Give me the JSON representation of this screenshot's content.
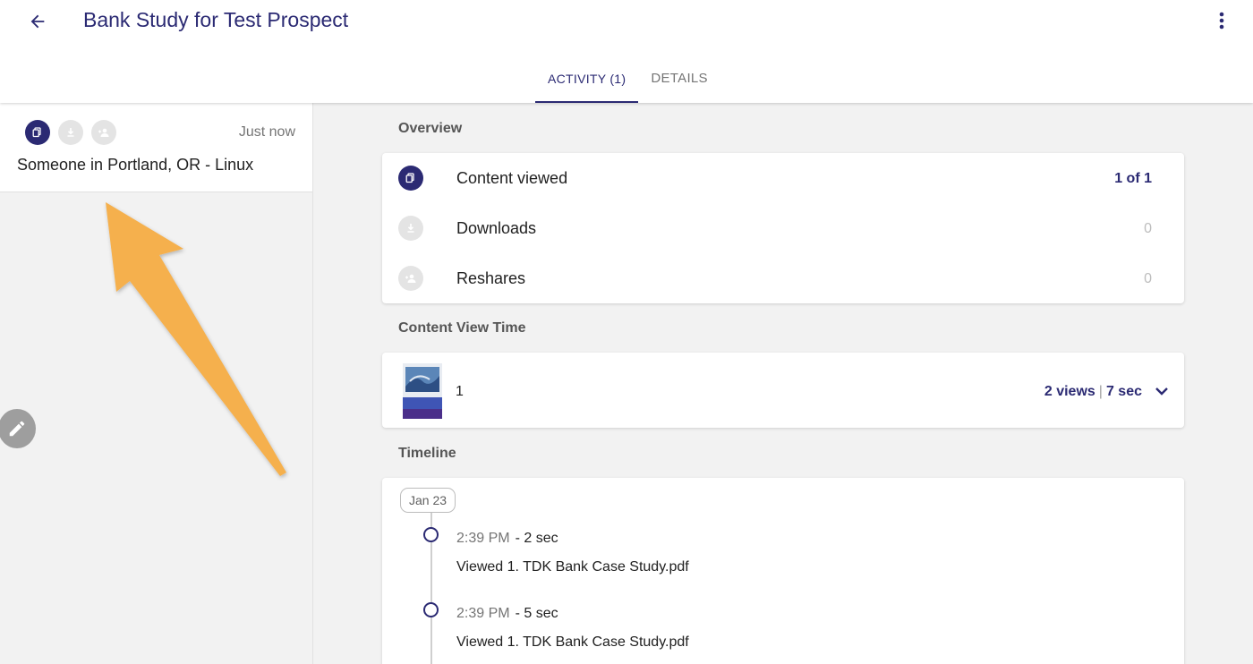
{
  "header": {
    "title": "Bank Study for Test Prospect",
    "back_icon": "arrow-left-icon",
    "more_icon": "more-vertical-icon",
    "tabs": [
      {
        "label": "ACTIVITY (1)",
        "active": true
      },
      {
        "label": "DETAILS",
        "active": false
      }
    ],
    "accent_color": "#2b2a73"
  },
  "activity_list": {
    "items": [
      {
        "time": "Just now",
        "visitor": "Someone in Portland, OR - Linux",
        "icons": [
          "content-viewed-icon",
          "download-icon",
          "reshare-icon"
        ]
      }
    ]
  },
  "overview": {
    "label": "Overview",
    "rows": [
      {
        "label": "Content viewed",
        "value": "1 of 1",
        "icon": "content-viewed-icon"
      },
      {
        "label": "Downloads",
        "value": "0",
        "icon": "download-icon"
      },
      {
        "label": "Reshares",
        "value": "0",
        "icon": "reshare-icon"
      }
    ]
  },
  "content_view_time": {
    "label": "Content View Time",
    "page": "1",
    "views": "2 views",
    "separator": "|",
    "duration": "7 sec"
  },
  "timeline": {
    "label": "Timeline",
    "date": "Jan 23",
    "events": [
      {
        "time": "2:39 PM",
        "duration": "- 2 sec",
        "description": "Viewed 1. TDK Bank Case Study.pdf"
      },
      {
        "time": "2:39 PM",
        "duration": "- 5 sec",
        "description": "Viewed 1. TDK Bank Case Study.pdf"
      }
    ]
  }
}
